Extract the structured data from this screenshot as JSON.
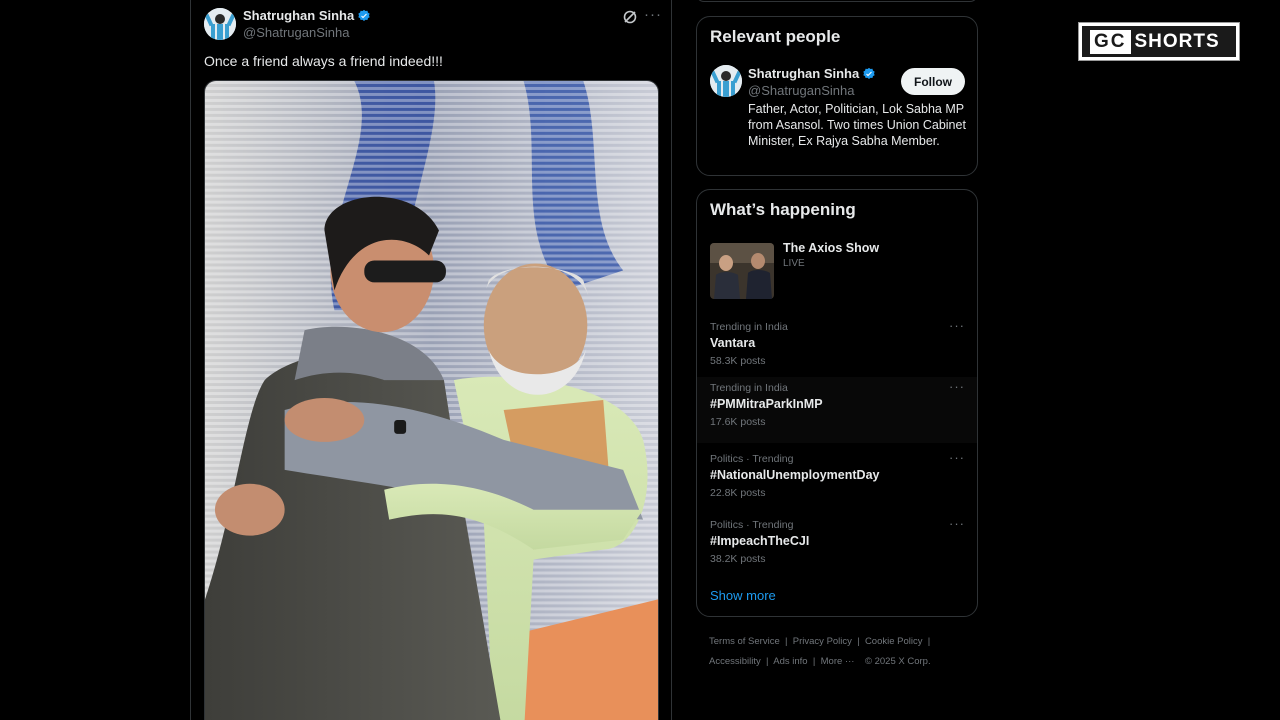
{
  "tweet": {
    "author_name": "Shatrughan Sinha",
    "author_handle": "@ShatruganSinha",
    "text": "Once a friend always a friend indeed!!!",
    "more_label": "···"
  },
  "relevant_people": {
    "title": "Relevant people",
    "person": {
      "name": "Shatrughan Sinha",
      "handle": "@ShatruganSinha",
      "follow_label": "Follow",
      "bio": "Father, Actor, Politician, Lok Sabha MP from Asansol. Two times Union Cabinet Minister, Ex Rajya Sabha Member."
    }
  },
  "whats_happening": {
    "title": "What’s happening",
    "live": {
      "title": "The Axios Show",
      "status": "LIVE"
    },
    "trends": [
      {
        "context": "Trending in India",
        "name": "Vantara",
        "count": "58.3K posts"
      },
      {
        "context": "Trending in India",
        "name": "#PMMitraParkInMP",
        "count": "17.6K posts"
      },
      {
        "context": "Politics · Trending",
        "name": "#NationalUnemploymentDay",
        "count": "22.8K posts"
      },
      {
        "context": "Politics · Trending",
        "name": "#ImpeachTheCJI",
        "count": "38.2K posts"
      }
    ],
    "more_label": "···",
    "show_more": "Show more"
  },
  "footer": {
    "terms": "Terms of Service",
    "privacy": "Privacy Policy",
    "cookie": "Cookie Policy",
    "accessibility": "Accessibility",
    "ads": "Ads info",
    "more": "More ···",
    "copyright": "© 2025 X Corp.",
    "separator": "|"
  },
  "logo": {
    "box": "GC",
    "text": "SHORTS"
  },
  "colors": {
    "accent": "#1d9bf0",
    "background": "#000000",
    "border": "#2f3336",
    "muted": "#71767b"
  }
}
